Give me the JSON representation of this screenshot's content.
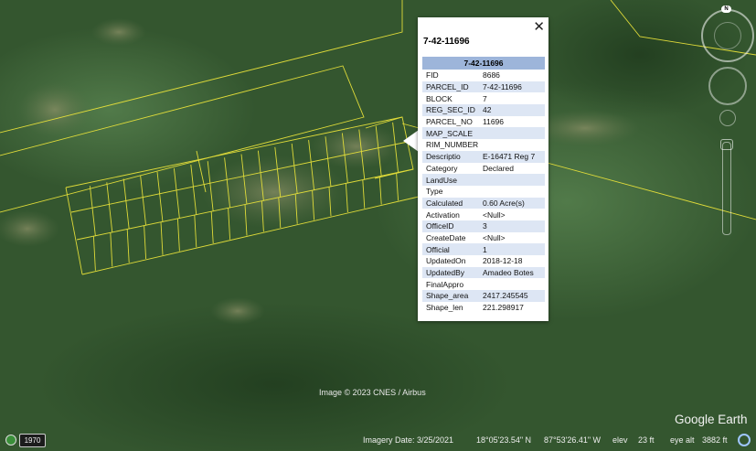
{
  "popup": {
    "close_icon": "close-icon",
    "title": "7-42-11696",
    "table_header": "7-42-11696",
    "rows": [
      {
        "key": "FID",
        "value": "8686"
      },
      {
        "key": "PARCEL_ID",
        "value": "7-42-11696"
      },
      {
        "key": "BLOCK",
        "value": "7"
      },
      {
        "key": "REG_SEC_ID",
        "value": "42"
      },
      {
        "key": "PARCEL_NO",
        "value": "11696"
      },
      {
        "key": "MAP_SCALE",
        "value": ""
      },
      {
        "key": "RIM_NUMBER",
        "value": ""
      },
      {
        "key": "Descriptio",
        "value": "E-16471 Reg 7"
      },
      {
        "key": "Category",
        "value": "Declared"
      },
      {
        "key": "LandUse",
        "value": ""
      },
      {
        "key": "Type",
        "value": ""
      },
      {
        "key": "Calculated",
        "value": "0.60 Acre(s)"
      },
      {
        "key": "Activation",
        "value": "<Null>"
      },
      {
        "key": "OfficeID",
        "value": "3"
      },
      {
        "key": "CreateDate",
        "value": "<Null>"
      },
      {
        "key": "Official",
        "value": "1"
      },
      {
        "key": "UpdatedOn",
        "value": "2018-12-18"
      },
      {
        "key": "UpdatedBy",
        "value": "Amadeo Botes"
      },
      {
        "key": "FinalAppro",
        "value": ""
      },
      {
        "key": "Shape_area",
        "value": "2417.245545"
      },
      {
        "key": "Shape_len",
        "value": "221.298917"
      }
    ]
  },
  "map": {
    "image_credit": "Image © 2023 CNES / Airbus",
    "logo": "Google Earth",
    "parcel_line_color": "#e8e23a"
  },
  "status": {
    "historical_icon": "history-clock-icon",
    "year": "1970",
    "imagery_date": "Imagery Date: 3/25/2021",
    "lat": "18°05'23.54\" N",
    "lon": "87°53'26.41\" W",
    "elev_label": "elev",
    "elev_value": "23 ft",
    "eye_alt_label": "eye alt",
    "eye_alt_value": "3882 ft",
    "streaming_icon": "streaming-status-icon"
  },
  "nav": {
    "north": "N",
    "compass_icon": "compass-icon",
    "look_icon": "look-joystick-icon",
    "pan_icon": "street-view-icon",
    "zoom_icon": "zoom-slider"
  }
}
